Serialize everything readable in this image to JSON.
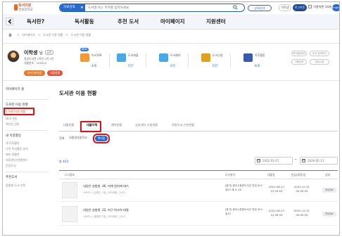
{
  "header": {
    "logo_top": "독서지원",
    "logo_bottom": "영성중학교",
    "search_scope": "자료검색",
    "search_placeholder": "도서명 또는 저자를 입력하세요.",
    "advanced_search": "상세검색",
    "user_label": "이학생",
    "logout_label": "로그아웃",
    "member_label": "이용약관 14세",
    "lang_label": "English"
  },
  "gnb": [
    "독서란?",
    "독서활동",
    "추천 도서",
    "마이페이지",
    "지원센터"
  ],
  "breadcrumb": [
    "마이페이지",
    "도서관 이용 현황",
    "도서관 이용 현황"
  ],
  "profile": {
    "name": "이학생",
    "honorific": "님",
    "level": "2기",
    "library": "영성도서관 1학년 1반 1번",
    "card": "대출번호 : 105024",
    "btn_notice": "온라인회원증",
    "btn_edit": "대출현황",
    "stats": [
      {
        "label": "독서목록",
        "value": "4개",
        "badge": "NEW",
        "color": "#f29a3a"
      },
      {
        "label": "도서대출",
        "value": "5건",
        "badge": "",
        "color": "#4aa8e8"
      },
      {
        "label": "도서예약",
        "value": "0건",
        "badge": "",
        "color": "#4aa8e8"
      },
      {
        "label": "도서신청",
        "value": "0건",
        "badge": "",
        "color": "#e0a020"
      },
      {
        "label": "독후활동",
        "value": "6개",
        "badge": "",
        "color": "#3a5ab0"
      }
    ],
    "side_buttons": [
      "독서앱/SNS",
      "도서 검색하기",
      "이용순위",
      "영상시청"
    ]
  },
  "sidebar": {
    "sections": [
      {
        "title": "마이페이지 홈",
        "items": []
      },
      {
        "title": "도서관 이용 현황",
        "items": [
          "도서관 이용 현황",
          "DLS 연동",
          "책이음 연동"
        ]
      },
      {
        "title": "내 독후활동",
        "items": [
          "내 독후활동",
          "나의 독서활동 분석",
          "배지 현황판",
          "의료관리/연결관리",
          "문장도서"
        ]
      },
      {
        "title": "추천도서",
        "items": [
          "맞춤형 도서 추천"
        ]
      }
    ]
  },
  "main": {
    "title": "도서관 이용 현황",
    "tabs": [
      "대출현황",
      "대출이력",
      "예약현황",
      "상호대차 신청현황",
      "희망도서 신청현황"
    ],
    "active_tab": 1,
    "filter_label": "전체",
    "filter_value": "서울영성중학교",
    "filter_button": "책이음",
    "total_prefix": "총 ",
    "total_count": "46",
    "total_suffix": "건",
    "date_from": "2022-01-01",
    "date_to": "2026-02-13",
    "columns": [
      "도서정보",
      "도서위치",
      "대출일",
      "반납(예정)일",
      "상태"
    ],
    "rows": [
      {
        "title": "내일은 실험왕. 46, 미래 연지에 대기",
        "meta": "스토리 a | 유병주 그림 | 아이세움 | 2022",
        "location": "[중기] 광주시표준도서관 전업 407-효25 세-노-16",
        "loan_date": "2022-08-27 12:29:05",
        "return_date": "2025-12-31 00:00:00",
        "status": "반납완료"
      },
      {
        "title": "내일은 실험왕. 22, 지구 박사의 대결",
        "meta": "스토리 a | 홍종현 그림 | 아이세움 | 2013",
        "location": "[중기] 광주시표준도서관 전업 407-효25",
        "loan_date": "2022-08-27 12:28:59",
        "return_date": "2025-12-31 00:00:00",
        "status": "반납완료"
      }
    ]
  }
}
